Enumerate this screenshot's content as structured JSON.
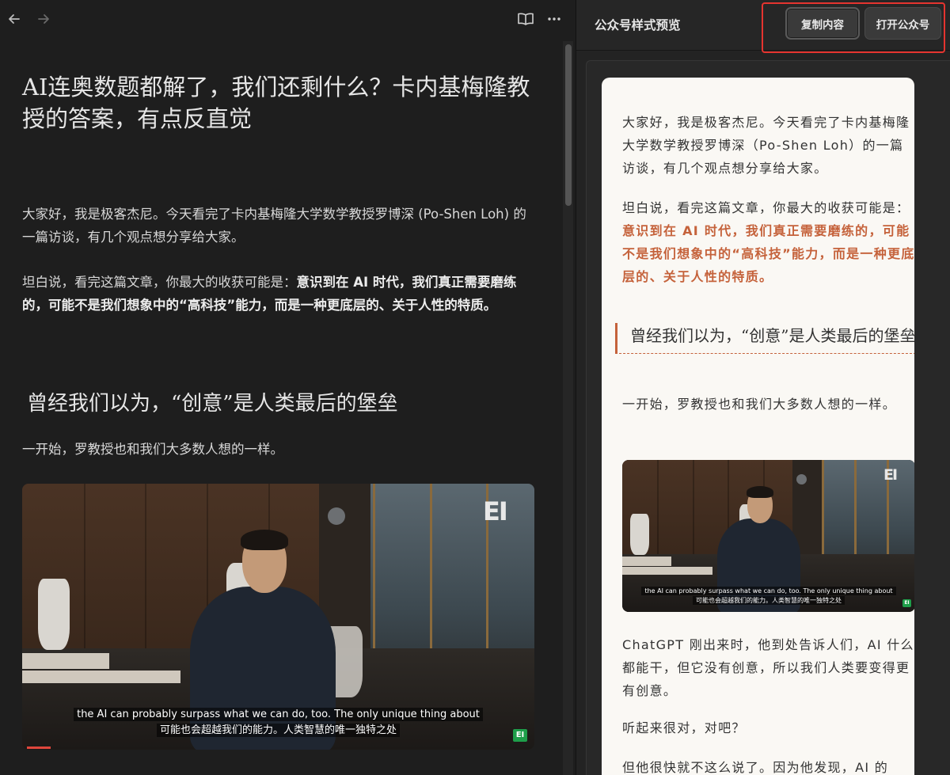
{
  "editor": {
    "title": "AI连奥数题都解了，我们还剩什么？卡内基梅隆教授的答案，有点反直觉",
    "intro1": "大家好，我是极客杰尼。今天看完了卡内基梅隆大学数学教授罗博深 (Po-Shen Loh) 的一篇访谈，有几个观点想分享给大家。",
    "intro2_prefix": "坦白说，看完这篇文章，你最大的收获可能是：",
    "intro2_bold": "意识到在 AI 时代，我们真正需要磨练的，可能不是我们想象中的“高科技”能力，而是一种更底层的、关于人性的特质。",
    "heading": "曾经我们以为，“创意”是人类最后的堡垒",
    "paragraph3": "一开始，罗教授也和我们大多数人想的一样。",
    "video": {
      "subtitle_en": "the AI can probably surpass what we can do, too. The only unique thing about",
      "subtitle_zh": "可能也会超越我们的能力。人类智慧的唯一独特之处",
      "logo": "EI",
      "badge": "EI"
    }
  },
  "preview": {
    "header_title": "公众号样式预览",
    "copy_label": "复制内容",
    "open_label": "打开公众号",
    "intro1": "大家好，我是极客杰尼。今天看完了卡内基梅隆大学数学教授罗博深（Po-Shen Loh）的一篇访谈，有几个观点想分享给大家。",
    "intro2_prefix": "坦白说，看完这篇文章，你最大的收获可能是：",
    "intro2_bold": "意识到在 AI 时代，我们真正需要磨练的，可能不是我们想象中的“高科技”能力，而是一种更底层的、关于人性的特质。",
    "heading": "曾经我们以为，“创意”是人类最后的堡垒",
    "paragraph3": "一开始，罗教授也和我们大多数人想的一样。",
    "paragraph4": "ChatGPT 刚出来时，他到处告诉人们，AI 什么都能干，但它没有创意，所以我们人类要变得更有创意。",
    "paragraph5": "听起来很对，对吧？",
    "paragraph6": "但他很快就不这么说了。因为他发现，AI 的",
    "accent_color": "#c5623b"
  },
  "icons": {
    "back": "arrow-left-icon",
    "forward": "arrow-right-icon",
    "reader": "book-open-icon",
    "more": "more-horizontal-icon"
  }
}
